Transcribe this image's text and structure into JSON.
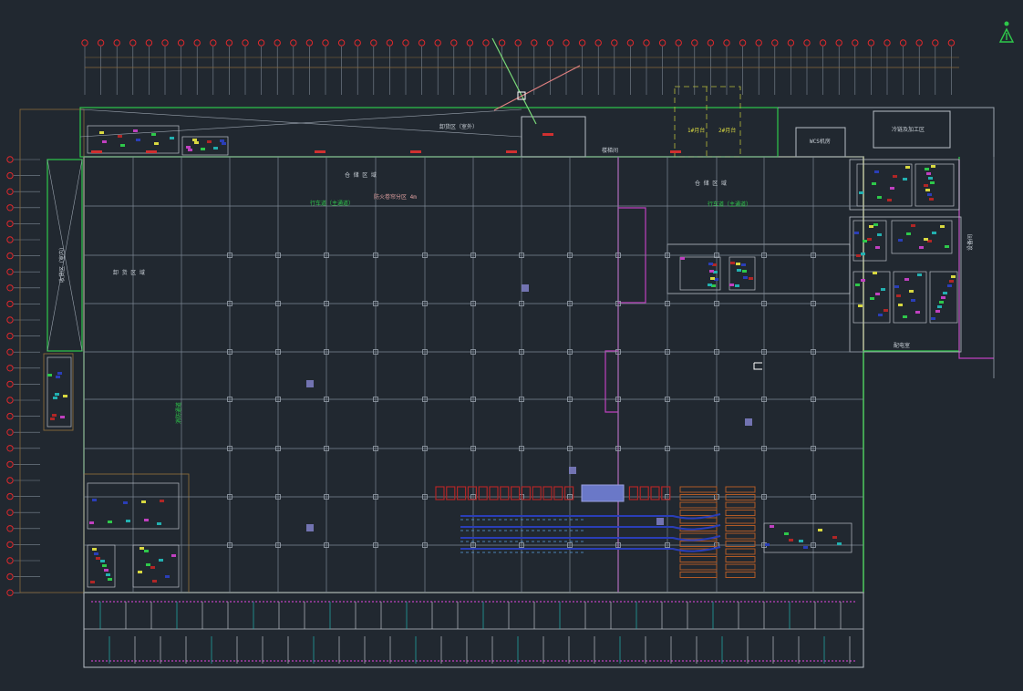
{
  "viewport": {
    "background": "#212830"
  },
  "colors": {
    "grid": "#7d8794",
    "column": "#9aa3ae",
    "wall": "#b8bec6",
    "outline": "#c8cfa6",
    "green": "#2ec84a",
    "magenta": "#c040c0",
    "cyan": "#22b0b0",
    "axis_bubble": "#e0282c",
    "red_equipment": "#b02626",
    "orange_equipment": "#b05a26",
    "blue_equipment": "#2a3eb8",
    "purple_marker": "#8080c8",
    "compass_x": "#78d878",
    "compass_y": "#e08080"
  },
  "labels": {
    "top_room": "卸货区（室外）",
    "zone_a": "仓 储 区 域",
    "zone_b": "仓 储 区 域",
    "zone_c": "仓 储 区 域",
    "zone_west": "卸 货 区 域",
    "green_note_a": "行车道（主通道）",
    "green_note_b": "行车道（主通道）",
    "green_vertical": "消防通道",
    "sub_note": "防火卷帘分区 4m",
    "west_vertical": "收货区（室内）",
    "office_box": "WCS机房",
    "right_room": "冷链及加工区",
    "east_vertical": "设备间",
    "dock_1": "1#月台",
    "dock_2": "2#月台",
    "stair_label": "楼梯间",
    "bottom_tag": "配电室"
  },
  "icons": {
    "ucs": "ucs-person-icon",
    "compass": "compass-crosshair-icon"
  }
}
